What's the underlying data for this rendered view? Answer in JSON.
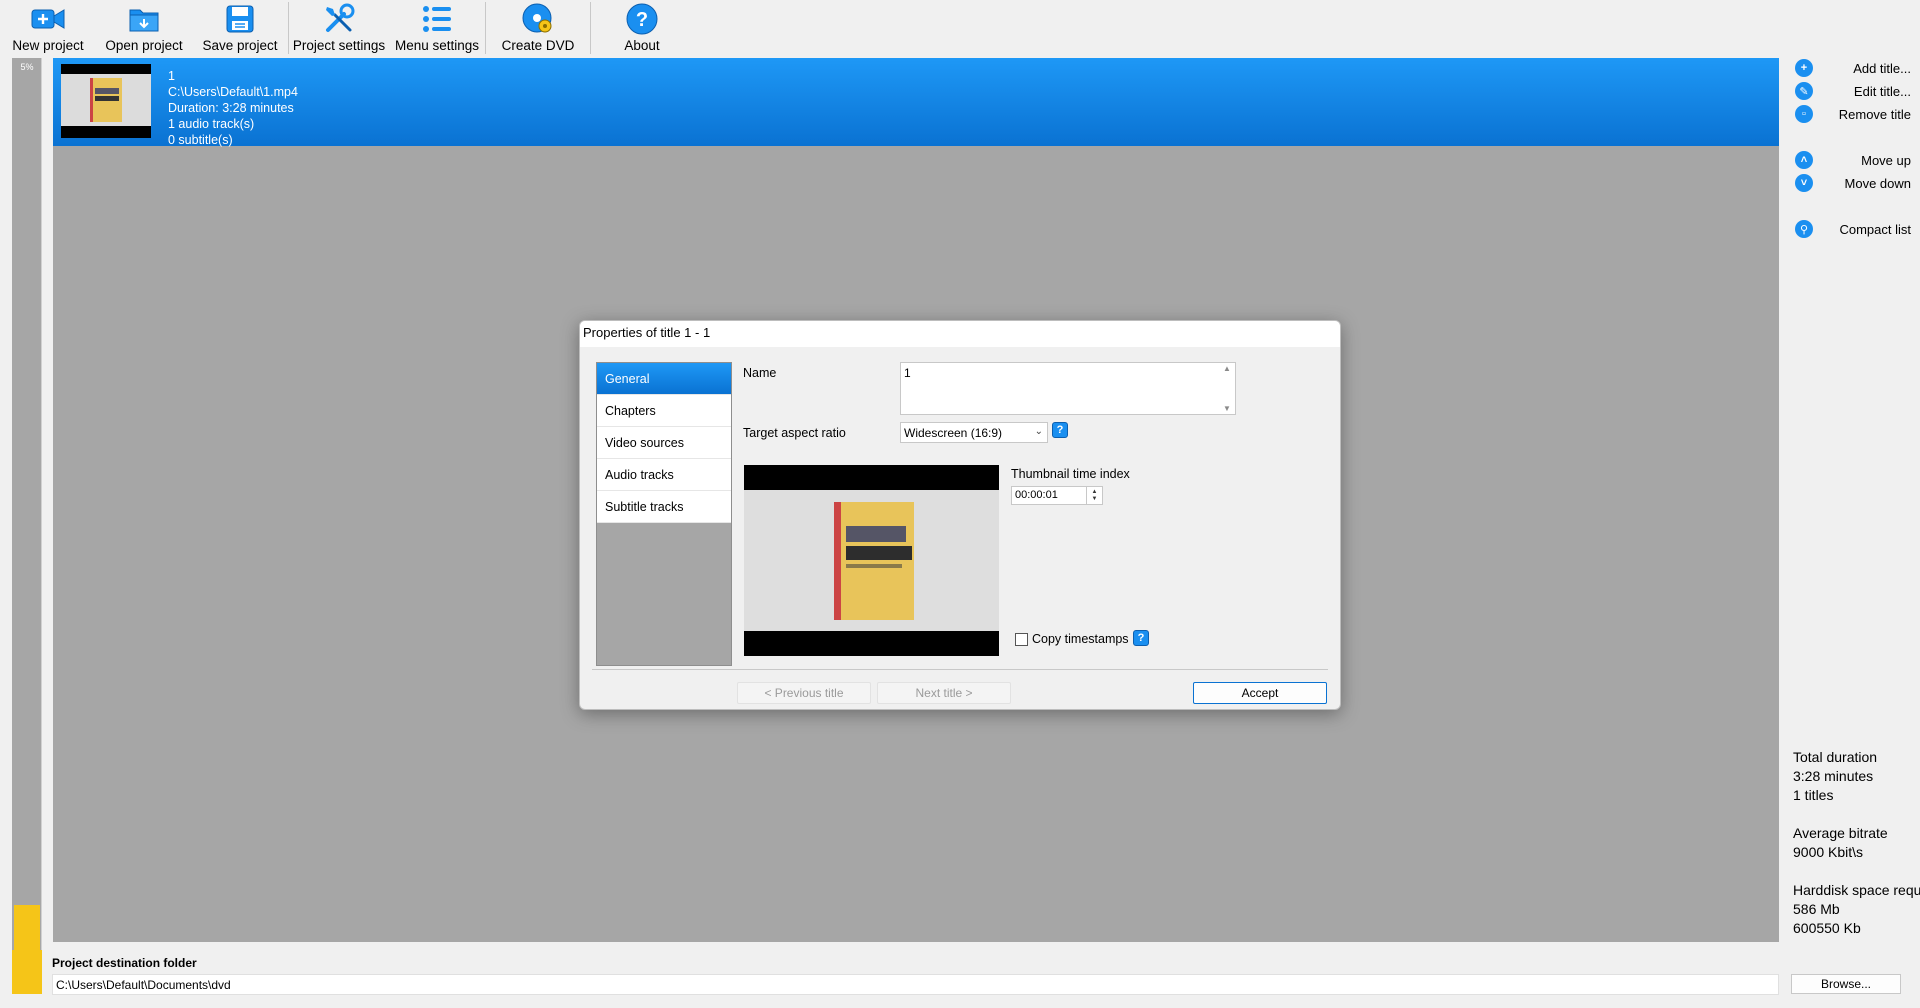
{
  "toolbar": {
    "new_project": "New project",
    "open_project": "Open project",
    "save_project": "Save project",
    "project_settings": "Project settings",
    "menu_settings": "Menu settings",
    "create_dvd": "Create DVD",
    "about": "About"
  },
  "progress": {
    "label": "5%",
    "fraction": 0.05
  },
  "title_list": [
    {
      "number": "1",
      "path": "C:\\Users\\Default\\1.mp4",
      "duration": "Duration: 3:28 minutes",
      "audio": "1 audio track(s)",
      "subtitles": "0 subtitle(s)"
    }
  ],
  "right_panel": {
    "add_title": "Add title...",
    "edit_title": "Edit title...",
    "remove_title": "Remove title",
    "move_up": "Move up",
    "move_down": "Move down",
    "compact_list": "Compact list",
    "stats": {
      "total_duration_label": "Total duration",
      "total_duration_value": "3:28 minutes",
      "titles_count": "1 titles",
      "avg_bitrate_label": "Average bitrate",
      "avg_bitrate_value": "9000 Kbit\\s",
      "hdd_label": "Harddisk space requi",
      "hdd_mb": "586 Mb",
      "hdd_kb": "600550 Kb"
    }
  },
  "bottom": {
    "dest_label": "Project destination folder",
    "dest_path": "C:\\Users\\Default\\Documents\\dvd",
    "browse": "Browse..."
  },
  "dialog": {
    "title": "Properties of title 1 - 1",
    "nav": [
      "General",
      "Chapters",
      "Video sources",
      "Audio tracks",
      "Subtitle tracks"
    ],
    "active_nav": "General",
    "name_label": "Name",
    "name_value": "1",
    "aspect_label": "Target aspect ratio",
    "aspect_value": "Widescreen (16:9)",
    "thumb_label": "Thumbnail time index",
    "thumb_time": "00:00:01",
    "copy_timestamps": "Copy timestamps",
    "copy_timestamps_checked": false,
    "prev_title": "< Previous title",
    "next_title": "Next title >",
    "accept": "Accept"
  },
  "colors": {
    "accent": "#1a8ff0",
    "selection": "#0a72d2",
    "list_bg": "#a6a6a6",
    "progress_fill": "#f5c518"
  },
  "icons": {
    "new_project": "video-camera-plus-icon",
    "open_project": "folder-icon",
    "save_project": "floppy-disk-icon",
    "project_settings": "wrench-screwdriver-icon",
    "menu_settings": "list-icon",
    "create_dvd": "disc-gear-icon",
    "about": "question-icon"
  }
}
